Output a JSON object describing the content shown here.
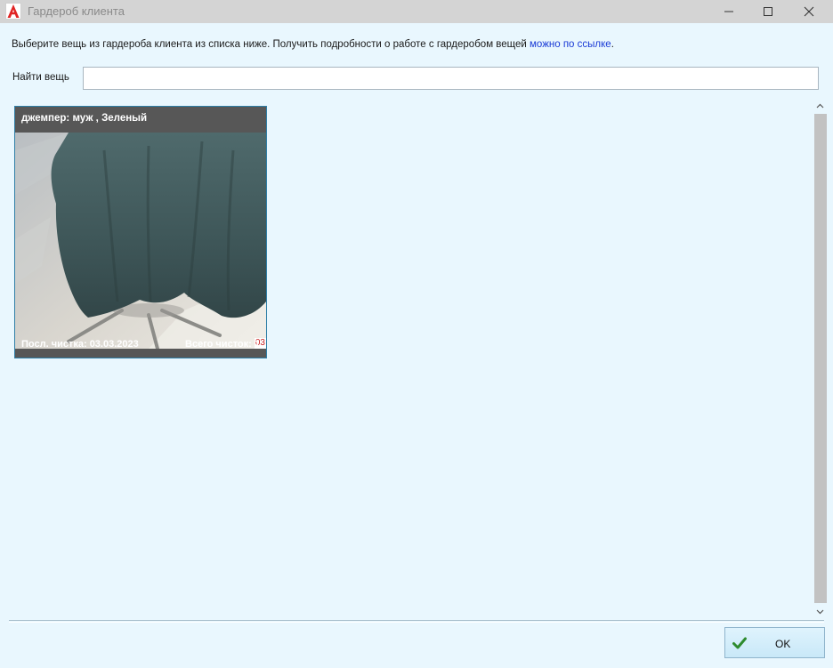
{
  "window": {
    "title": "Гардероб клиента",
    "icon": "app-logo-icon",
    "controls": [
      "minimize-icon",
      "maximize-icon",
      "close-icon"
    ]
  },
  "instruction": {
    "text": "Выберите вещь из гардероба клиента из списка ниже. Получить подробности о работе с гардеробом вещей ",
    "link_text": "можно по ссылке",
    "tail": "."
  },
  "search": {
    "label": "Найти вещь",
    "value": "",
    "placeholder": ""
  },
  "items": [
    {
      "title": "джемпер: муж , Зеленый",
      "badge": "03",
      "last_cleaning": "Посл. чистка: 03.03.2023",
      "total_cleanings": "Всего чисток: 1"
    }
  ],
  "footer": {
    "ok_label": "OK",
    "ok_icon": "check-icon"
  },
  "colors": {
    "background": "#e9f7fe",
    "titlebar": "#d4d4d4",
    "card_bg": "#575757",
    "card_border": "#2f7fa7",
    "link": "#1a3bd6",
    "badge_text": "#c81e1e",
    "check": "#2e8b2e"
  }
}
